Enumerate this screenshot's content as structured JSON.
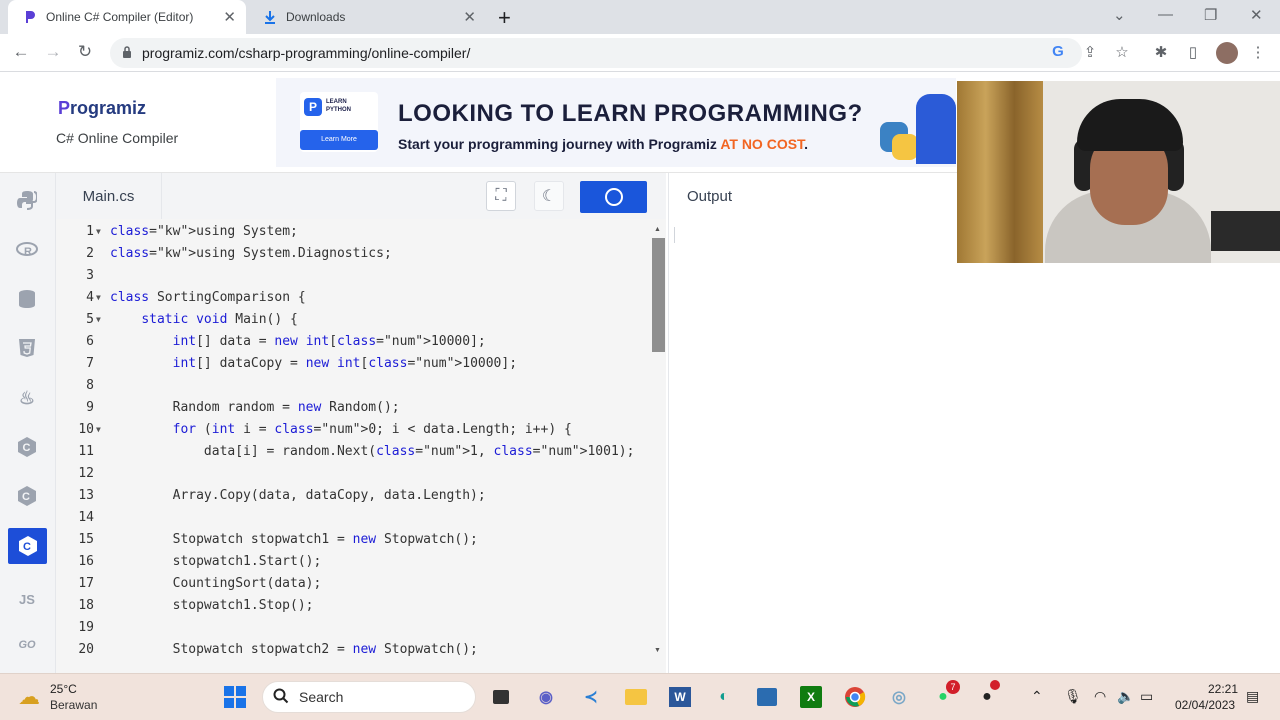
{
  "browser": {
    "tabs": [
      {
        "title": "Online C# Compiler (Editor)",
        "active": true
      },
      {
        "title": "Downloads",
        "active": false
      }
    ],
    "new_tab": "+",
    "url": "programiz.com/csharp-programming/online-compiler/"
  },
  "header": {
    "logo": "Programiz",
    "subtitle": "C# Online Compiler"
  },
  "ad": {
    "badge_line1": "LEARN",
    "badge_line2": "PYTHON",
    "badge_button": "Learn More",
    "headline": "LOOKING TO LEARN PROGRAMMING?",
    "sub_prefix": "Start your programming journey with Programiz",
    "sub_highlight": "AT NO COST",
    "sub_suffix": "."
  },
  "sidebar": {
    "items": [
      {
        "name": "python",
        "icon": "python-icon"
      },
      {
        "name": "r",
        "icon": "r-icon"
      },
      {
        "name": "sql",
        "icon": "database-icon"
      },
      {
        "name": "html",
        "icon": "html5-icon"
      },
      {
        "name": "java",
        "icon": "java-icon"
      },
      {
        "name": "c",
        "icon": "c-icon"
      },
      {
        "name": "cpp",
        "icon": "cpp-icon"
      },
      {
        "name": "csharp",
        "icon": "csharp-icon",
        "active": true
      },
      {
        "name": "js",
        "label": "JS"
      },
      {
        "name": "go",
        "label": "GO"
      }
    ]
  },
  "editor": {
    "file_tab": "Main.cs",
    "lines": [
      {
        "n": "1",
        "fold": true,
        "text": "using System;"
      },
      {
        "n": "2",
        "fold": false,
        "text": "using System.Diagnostics;"
      },
      {
        "n": "3",
        "fold": false,
        "text": ""
      },
      {
        "n": "4",
        "fold": true,
        "text": "class SortingComparison {"
      },
      {
        "n": "5",
        "fold": true,
        "text": "    static void Main() {"
      },
      {
        "n": "6",
        "fold": false,
        "text": "        int[] data = new int[10000];"
      },
      {
        "n": "7",
        "fold": false,
        "text": "        int[] dataCopy = new int[10000];"
      },
      {
        "n": "8",
        "fold": false,
        "text": ""
      },
      {
        "n": "9",
        "fold": false,
        "text": "        Random random = new Random();"
      },
      {
        "n": "10",
        "fold": true,
        "text": "        for (int i = 0; i < data.Length; i++) {"
      },
      {
        "n": "11",
        "fold": false,
        "text": "            data[i] = random.Next(1, 1001);        }"
      },
      {
        "n": "12",
        "fold": false,
        "text": ""
      },
      {
        "n": "13",
        "fold": false,
        "text": "        Array.Copy(data, dataCopy, data.Length);"
      },
      {
        "n": "14",
        "fold": false,
        "text": ""
      },
      {
        "n": "15",
        "fold": false,
        "text": "        Stopwatch stopwatch1 = new Stopwatch();"
      },
      {
        "n": "16",
        "fold": false,
        "text": "        stopwatch1.Start();"
      },
      {
        "n": "17",
        "fold": false,
        "text": "        CountingSort(data);"
      },
      {
        "n": "18",
        "fold": false,
        "text": "        stopwatch1.Stop();"
      },
      {
        "n": "19",
        "fold": false,
        "text": ""
      },
      {
        "n": "20",
        "fold": false,
        "text": "        Stopwatch stopwatch2 = new Stopwatch();"
      }
    ]
  },
  "output": {
    "label": "Output"
  },
  "taskbar": {
    "weather_temp": "25°C",
    "weather_desc": "Berawan",
    "search_placeholder": "Search",
    "chrome_badge": "7",
    "clock_time": "22:21",
    "clock_date": "02/04/2023"
  },
  "colors": {
    "accent": "#1a56db",
    "keyword": "#1c1cd6",
    "number": "#098658",
    "ad_highlight": "#f26522"
  }
}
